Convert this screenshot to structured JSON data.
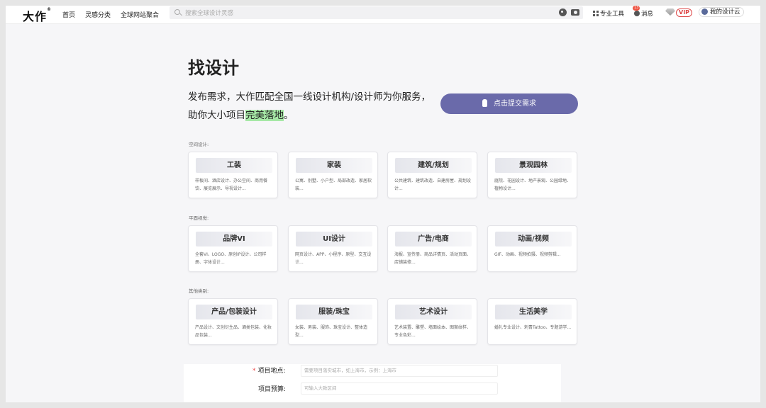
{
  "nav": {
    "logo": "大作",
    "logo_mark": "®",
    "links": [
      "首页",
      "灵感分类",
      "全球网站聚合"
    ],
    "search_placeholder": "搜索全球设计灵感",
    "tools": "专业工具",
    "messages": "消息",
    "messages_badge": "13",
    "vip": "VIP",
    "my_cloud": "我的设计云"
  },
  "hero": {
    "title": "找设计",
    "intro_line1": "发布需求，大作匹配全国一线设计机构/设计师为你服务，",
    "intro_line2_pre": "助你大小项目",
    "intro_line2_highlight": "完美落地",
    "intro_line2_post": "。",
    "submit_button": "点击提交需求"
  },
  "sections": [
    {
      "label": "空间设计:",
      "cards": [
        {
          "title": "工装",
          "desc": "样板间、酒店设计、办公空间、商用餐饮、展览展示、导视设计..."
        },
        {
          "title": "家装",
          "desc": "公寓、别墅、小户型、局部改造、家居软装..."
        },
        {
          "title": "建筑/规划",
          "desc": "公共建筑、建筑改造、自建房屋、规划设计..."
        },
        {
          "title": "景观园林",
          "desc": "庭院、花园设计、地产景观、公园绿地、植物设计..."
        }
      ]
    },
    {
      "label": "平面视觉:",
      "cards": [
        {
          "title": "品牌VI",
          "desc": "全套VI、LOGO、原创IP设计、公司样册、字体设计..."
        },
        {
          "title": "UI设计",
          "desc": "网页设计、APP、小程序、原型、交互设计..."
        },
        {
          "title": "广告/电商",
          "desc": "海报、宣传册、商品详情页、活动页面、店铺装修..."
        },
        {
          "title": "动画/视频",
          "desc": "GIF、动画、视频拍摄、视频剪辑..."
        }
      ]
    },
    {
      "label": "其他类别:",
      "cards": [
        {
          "title": "产品/包装设计",
          "desc": "产品设计、文创衍生品、酒类包装、化妆品包装..."
        },
        {
          "title": "服装/珠宝",
          "desc": "女装、男装、服饰、珠宝设计、整体造型..."
        },
        {
          "title": "艺术设计",
          "desc": "艺术装置、雕塑、墙面绘本、图案纹样、专业色彩..."
        },
        {
          "title": "生活美学",
          "desc": "婚礼专业设计、刺青Tattoo、专题游学..."
        }
      ]
    }
  ],
  "form": {
    "location_label": "项目地点:",
    "location_placeholder": "需要项目落实城市，如上海市，示例：上海市",
    "budget_label": "项目预算:",
    "budget_placeholder": "可输入大致区间"
  }
}
